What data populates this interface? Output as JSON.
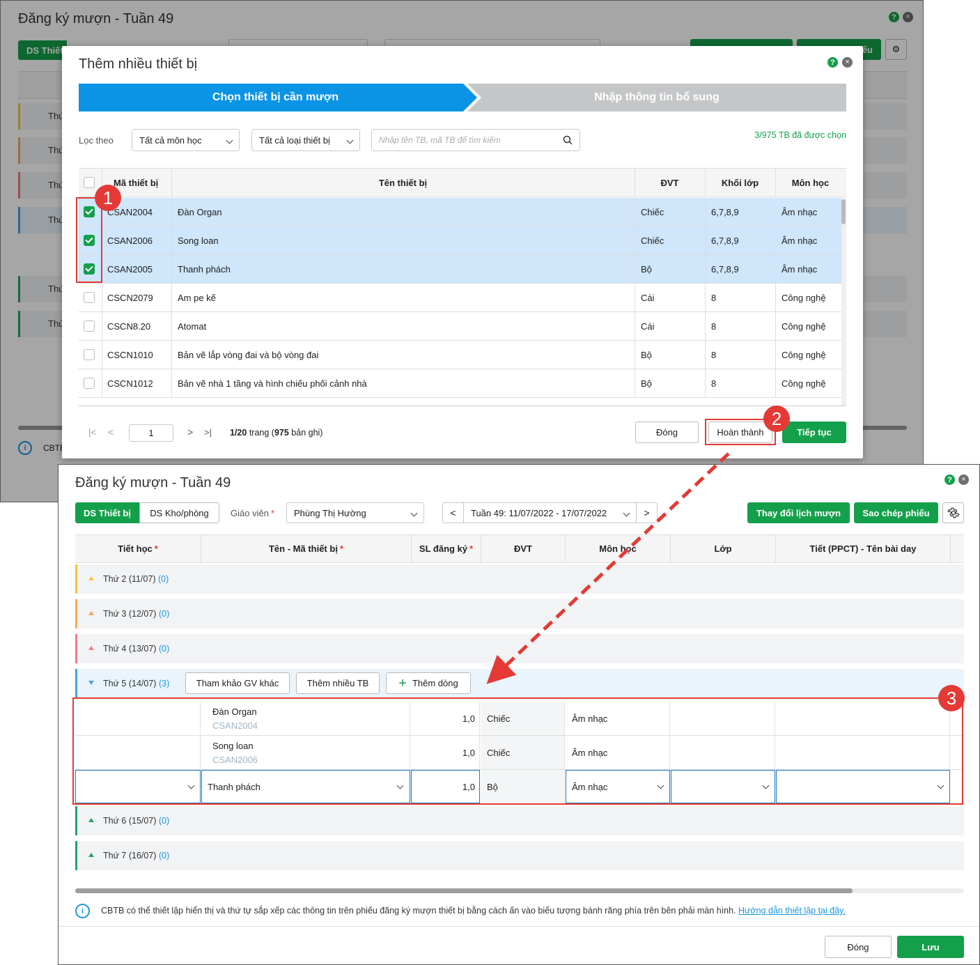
{
  "bg_window": {
    "title": "Đăng ký mượn - Tuần 49",
    "tab_active_partial": "DS Thiết",
    "btn_partial": "ếu",
    "day_partial": "Thứ",
    "info_partial": "CBTB"
  },
  "modal": {
    "title": "Thêm nhiều thiết bị",
    "steps": [
      "Chọn thiết bị cần mượn",
      "Nhập thông tin bổ sung"
    ],
    "filter_label": "Lọc theo",
    "subject_filter": "Tất cả môn học",
    "type_filter": "Tất cả loại thiết bị",
    "search_placeholder": "Nhập tên TB, mã TB để tìm kiếm",
    "selected_count": "3/975 TB đã được chọn",
    "columns": [
      "Mã thiết bị",
      "Tên thiết bị",
      "ĐVT",
      "Khối lớp",
      "Môn học"
    ],
    "rows": [
      {
        "code": "CSAN2004",
        "name": "Đàn Organ",
        "unit": "Chiếc",
        "grade": "6,7,8,9",
        "subject": "Âm nhạc",
        "checked": true
      },
      {
        "code": "CSAN2006",
        "name": "Song loan",
        "unit": "Chiếc",
        "grade": "6,7,8,9",
        "subject": "Âm nhạc",
        "checked": true
      },
      {
        "code": "CSAN2005",
        "name": "Thanh phách",
        "unit": "Bộ",
        "grade": "6,7,8,9",
        "subject": "Âm nhạc",
        "checked": true
      },
      {
        "code": "CSCN2079",
        "name": "Am pe kế",
        "unit": "Cái",
        "grade": "8",
        "subject": "Công nghệ",
        "checked": false
      },
      {
        "code": "CSCN8.20",
        "name": "Atomat",
        "unit": "Cái",
        "grade": "8",
        "subject": "Công nghệ",
        "checked": false
      },
      {
        "code": "CSCN1010",
        "name": "Bản vẽ lắp vòng đai và bộ vòng đai",
        "unit": "Bộ",
        "grade": "8",
        "subject": "Công nghệ",
        "checked": false
      },
      {
        "code": "CSCN1012",
        "name": "Bản vẽ nhà 1 tầng và hình chiếu phối cảnh nhà",
        "unit": "Bộ",
        "grade": "8",
        "subject": "Công nghệ",
        "checked": false
      }
    ],
    "page_input": "1",
    "page_info_a": "1/20",
    "page_info_b": " trang (",
    "page_info_c": "975",
    "page_info_d": " bản ghi)",
    "btn_close": "Đóng",
    "btn_finish": "Hoàn thành",
    "btn_continue": "Tiếp tục"
  },
  "main": {
    "title": "Đăng ký mượn - Tuần 49",
    "tab_devices": "DS Thiết bị",
    "tab_rooms": "DS Kho/phòng",
    "teacher_label": "Giáo viên",
    "teacher_value": "Phùng Thị Hường",
    "week_value": "Tuần 49: 11/07/2022 - 17/07/2022",
    "btn_change": "Thay đổi lịch mượn",
    "btn_copy": "Sao chép phiếu",
    "columns": {
      "period": "Tiết học",
      "device": "Tên - Mã thiết bị",
      "qty": "SL đăng ký",
      "unit": "ĐVT",
      "subject": "Môn học",
      "class": "Lớp",
      "lesson": "Tiết (PPCT) - Tên bài day"
    },
    "days": [
      {
        "label": "Thứ 2 (11/07)",
        "count": "(0)"
      },
      {
        "label": "Thứ 3 (12/07)",
        "count": "(0)"
      },
      {
        "label": "Thứ 4 (13/07)",
        "count": "(0)"
      },
      {
        "label": "Thứ 5 (14/07)",
        "count": "(3)"
      },
      {
        "label": "Thứ 6 (15/07)",
        "count": "(0)"
      },
      {
        "label": "Thứ 7 (16/07)",
        "count": "(0)"
      }
    ],
    "btn_ref": "Tham khảo GV khác",
    "btn_add_many": "Thêm nhiều TB",
    "btn_add_row": "Thêm dòng",
    "entries": [
      {
        "name": "Đàn Organ",
        "code": "CSAN2004",
        "qty": "1,0",
        "unit": "Chiếc",
        "subject": "Âm nhạc"
      },
      {
        "name": "Song loan",
        "code": "CSAN2006",
        "qty": "1,0",
        "unit": "Chiếc",
        "subject": "Âm nhạc"
      },
      {
        "name": "Thanh phách",
        "code": "",
        "qty": "1,0",
        "unit": "Bộ",
        "subject": "Âm nhạc"
      }
    ],
    "info_text": "CBTB có thể thiết lập hiển thị và thứ tự sắp xếp các thông tin trên phiếu đăng ký mượn thiết bị bằng cách ấn vào biểu tượng bánh răng phía trên bên phải màn hình. ",
    "info_link": "Hướng dẫn thiết lập tại đây.",
    "btn_close": "Đóng",
    "btn_save": "Lưu"
  },
  "annotations": [
    "1",
    "2",
    "3"
  ],
  "colors": {
    "green": "#14a04b",
    "blue_step": "#0b94e6",
    "red_annot": "#e53935",
    "link": "#1b95e0"
  }
}
